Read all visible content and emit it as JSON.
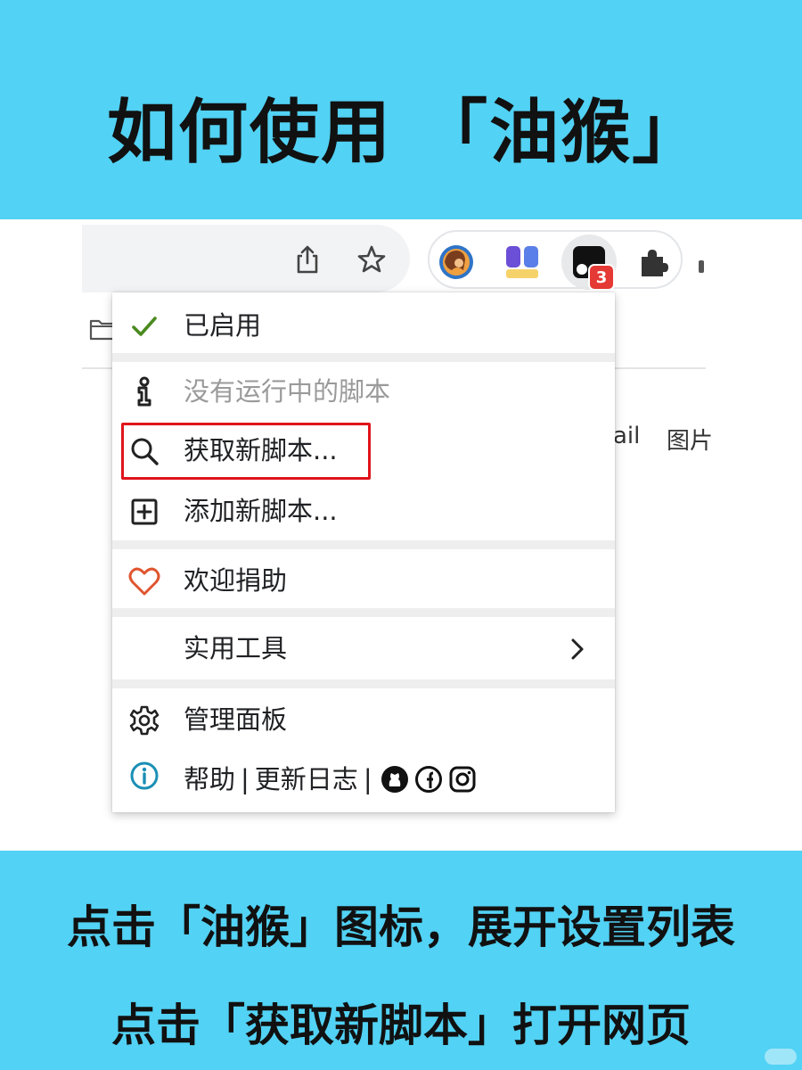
{
  "header": {
    "title": "如何使用 「油猴」"
  },
  "toolbar": {
    "share_icon": "share-icon",
    "bookmark_icon": "star-icon",
    "extensions": [
      "avatar-extension",
      "translate-extension",
      "tampermonkey",
      "puzzle-extensions"
    ],
    "tampermonkey_badge": "3"
  },
  "background": {
    "link_mail": "ail",
    "link_images": "图片"
  },
  "menu": {
    "enabled": "已启用",
    "no_scripts": "没有运行中的脚本",
    "get_new": "获取新脚本...",
    "add_new": "添加新脚本...",
    "donate": "欢迎捐助",
    "utilities": "实用工具",
    "dashboard": "管理面板",
    "help": "帮助",
    "separator": "|",
    "changelog": "更新日志",
    "social_icons": [
      "github-icon",
      "facebook-icon",
      "instagram-icon"
    ]
  },
  "footer": {
    "line1": "点击「油猴」图标，展开设置列表",
    "line2": "点击「获取新脚本」打开网页"
  },
  "colors": {
    "banner": "#52d2f4",
    "highlight": "#e0141c",
    "check": "#4a8a1f",
    "heart": "#e0552e",
    "info": "#1a8fb5",
    "badge": "#e53935"
  }
}
